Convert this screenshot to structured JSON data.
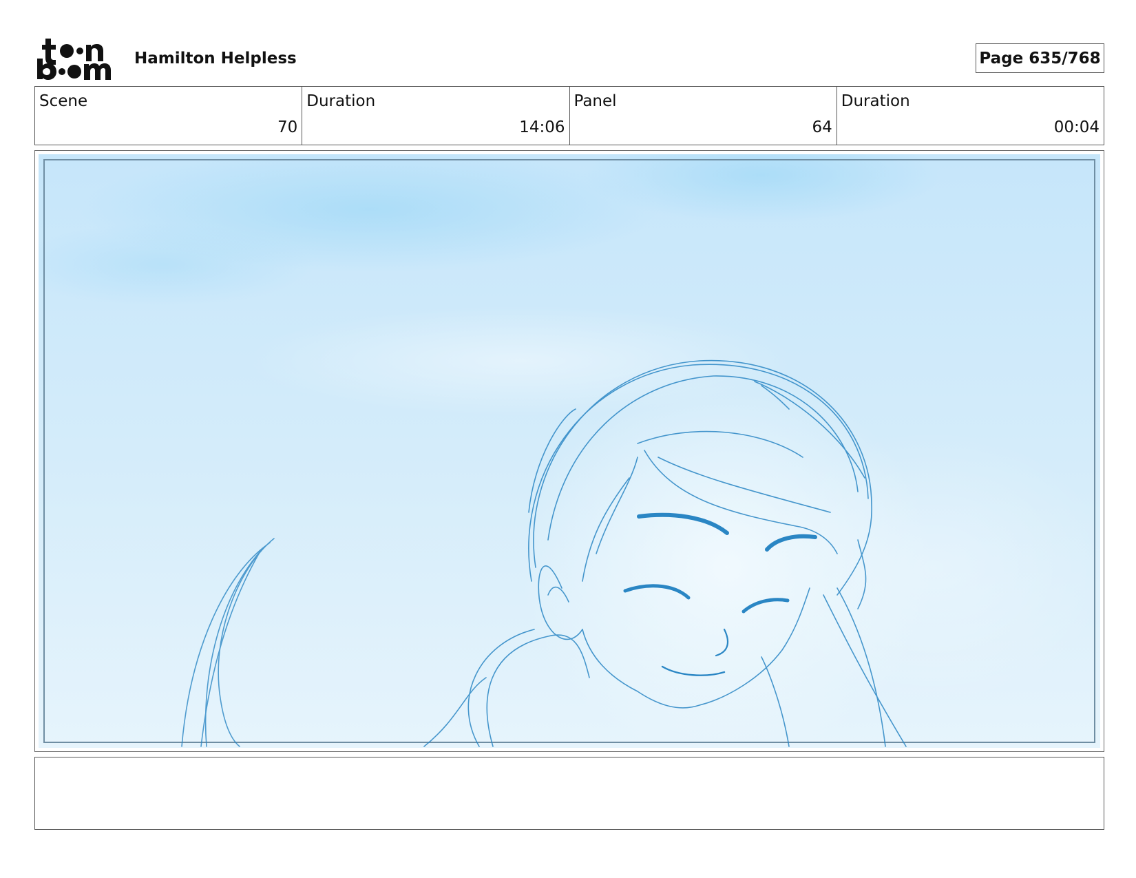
{
  "header": {
    "logo_icon": "toon-boom-logo",
    "logo_text": "toon boom",
    "project_title": "Hamilton Helpless",
    "page_indicator": "Page 635/768"
  },
  "info_table": {
    "scene_label": "Scene",
    "scene_value": "70",
    "scene_duration_label": "Duration",
    "scene_duration_value": "14:06",
    "panel_label": "Panel",
    "panel_value": "64",
    "panel_duration_label": "Duration",
    "panel_duration_value": "00:04"
  },
  "panel": {
    "image_icon": "storyboard-sketch-image",
    "sky_color": "#cfeafb",
    "line_color": "#2a86c4"
  },
  "notes": {
    "text": ""
  }
}
